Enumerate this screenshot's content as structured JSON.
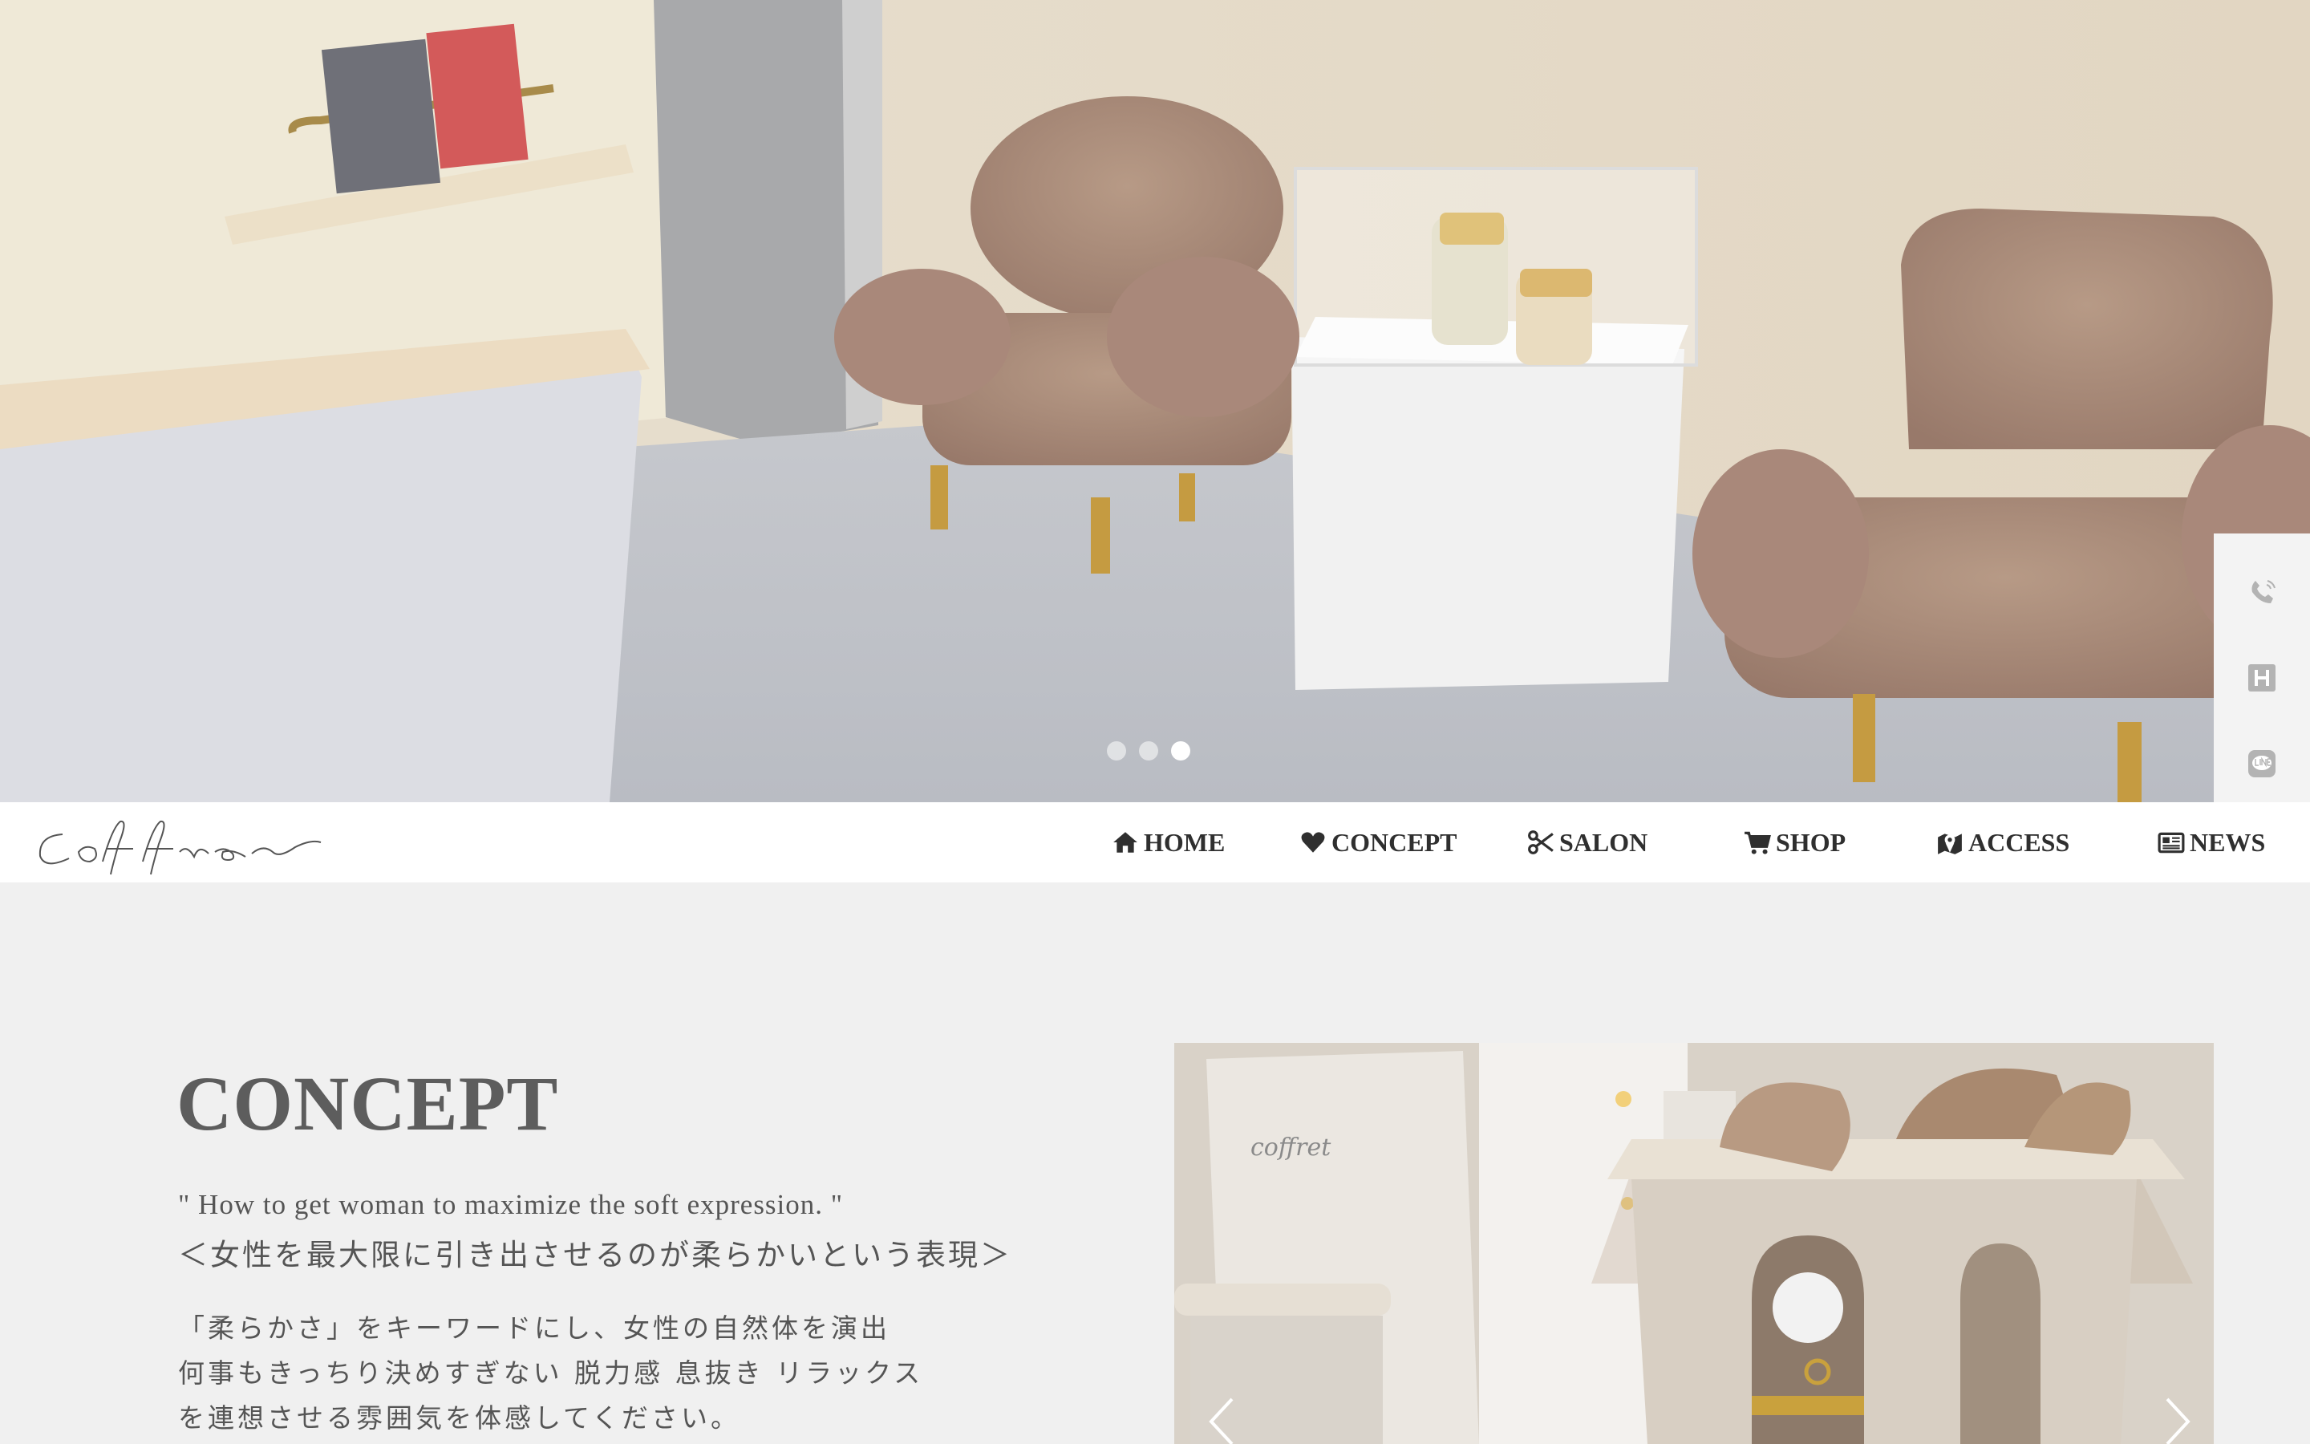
{
  "hero": {
    "slides": [
      "slide-1",
      "slide-2",
      "slide-3"
    ],
    "active_slide": 3
  },
  "side_buttons": [
    {
      "icon": "phone-icon"
    },
    {
      "icon": "hotpepper-icon"
    },
    {
      "icon": "line-icon"
    }
  ],
  "brand": {
    "logo_text": "coffret"
  },
  "nav": {
    "items": [
      {
        "label": "HOME",
        "icon": "home-icon"
      },
      {
        "label": "CONCEPT",
        "icon": "heart-icon"
      },
      {
        "label": "SALON",
        "icon": "scissors-icon"
      },
      {
        "label": "SHOP",
        "icon": "cart-icon"
      },
      {
        "label": "ACCESS",
        "icon": "map-icon"
      },
      {
        "label": "NEWS",
        "icon": "newspaper-icon"
      }
    ]
  },
  "concept": {
    "title": "CONCEPT",
    "quote_en": "\" How to get woman to maximize the soft expression. \"",
    "quote_ja": "＜女性を最大限に引き出させるのが柔らかいという表現＞",
    "body_lines": [
      "「柔らかさ」をキーワードにし、女性の自然体を演出",
      "何事もきっちり決めすぎない 脱力感 息抜き リラックス",
      "を連想させる雰囲気を体感してください。"
    ]
  },
  "colors": {
    "nav_text": "#2f2f2f",
    "title": "#5d5d5d",
    "body": "#555555",
    "background": "#f0f0f0"
  }
}
